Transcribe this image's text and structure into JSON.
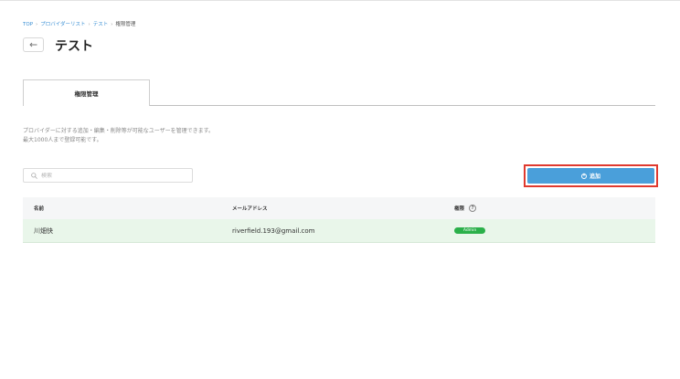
{
  "breadcrumb": {
    "items": [
      "TOP",
      "プロバイダーリスト",
      "テスト"
    ],
    "current": "権限管理",
    "separator": "›"
  },
  "header": {
    "back_icon": "arrow-left-icon",
    "title": "テスト"
  },
  "tabs": [
    {
      "label": "権限管理",
      "active": true
    }
  ],
  "description": {
    "line1": "プロバイダーに対する追加・編集・削除等が可能なユーザーを管理できます。",
    "line2": "最大1000人まで登録可能です。"
  },
  "search": {
    "placeholder": "検索",
    "value": "",
    "icon": "search-icon"
  },
  "add_button": {
    "label": "追加",
    "icon": "plus-circle-icon",
    "color": "#4a9fda"
  },
  "table": {
    "columns": [
      "名前",
      "メールアドレス",
      "権限"
    ],
    "help_icon": "?",
    "rows": [
      {
        "name": "川畑快",
        "email": "riverfield.193@gmail.com",
        "role": "Admin"
      }
    ]
  },
  "colors": {
    "accent": "#4a9fda",
    "highlight_border": "#e03a2f",
    "badge": "#2bb04a",
    "row_bg": "#e9f6ea"
  }
}
